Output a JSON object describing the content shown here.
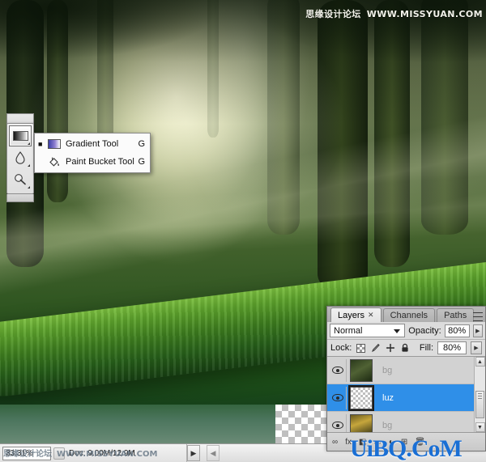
{
  "app": "Adobe Photoshop",
  "watermarks": {
    "top_cn": "思缘设计论坛",
    "top_url": "WWW.MISSYUAN.COM",
    "status_cn": "思缘设计论坛",
    "status_url": "WWW.MISSYUAN.COM",
    "panel_overlay": "UiBQ.CoM"
  },
  "status_bar": {
    "zoom": "33.31%",
    "doc_size": "Doc: 9.00M/12.9M",
    "scroll_right_arrow": "▶",
    "scroll_left_arrow": "◀"
  },
  "toolbar": {
    "tools": [
      {
        "name": "gradient-tool",
        "selected": true,
        "has_flyout": true
      },
      {
        "name": "blur-tool",
        "selected": false,
        "has_flyout": true
      },
      {
        "name": "dodge-tool",
        "selected": false,
        "has_flyout": true
      }
    ]
  },
  "flyout": {
    "items": [
      {
        "label": "Gradient Tool",
        "shortcut": "G",
        "active": true,
        "icon": "gradient-icon"
      },
      {
        "label": "Paint Bucket Tool",
        "shortcut": "G",
        "active": false,
        "icon": "paint-bucket-icon"
      }
    ]
  },
  "layers_panel": {
    "tabs": [
      {
        "label": "Layers",
        "active": true,
        "closable": true
      },
      {
        "label": "Channels",
        "active": false,
        "closable": false
      },
      {
        "label": "Paths",
        "active": false,
        "closable": false
      }
    ],
    "window_buttons": {
      "minimize": "–",
      "close": "✕"
    },
    "blend_mode": "Normal",
    "opacity_label": "Opacity:",
    "opacity_value": "80%",
    "lock_label": "Lock:",
    "fill_label": "Fill:",
    "fill_value": "80%",
    "lock_icons": [
      "lock-transparent-pixels-icon",
      "lock-image-pixels-icon",
      "lock-position-icon",
      "lock-all-icon"
    ],
    "layers": [
      {
        "name": "bg",
        "visible": true,
        "selected": false,
        "thumb": "dark-forest"
      },
      {
        "name": "luz",
        "visible": true,
        "selected": true,
        "thumb": "light-gradient-transparent"
      },
      {
        "name": "bg",
        "visible": true,
        "selected": false,
        "thumb": "golden-forest"
      }
    ],
    "footer_icons": [
      "link-layers-icon",
      "layer-style-icon",
      "layer-mask-icon",
      "new-group-icon",
      "adjustment-layer-icon",
      "new-layer-icon",
      "delete-layer-icon"
    ]
  }
}
